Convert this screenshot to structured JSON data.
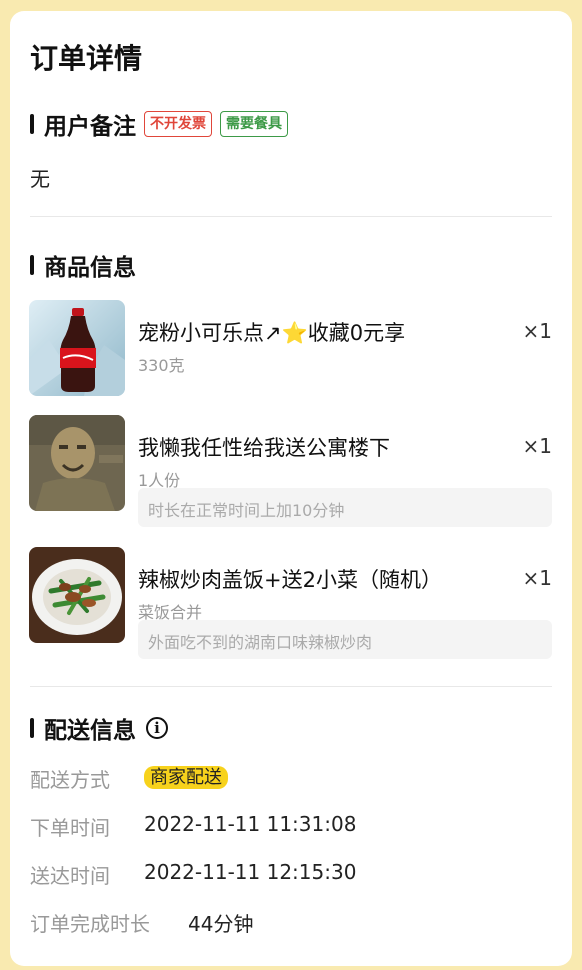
{
  "page": {
    "title": "订单详情"
  },
  "remarks": {
    "title": "用户备注",
    "tags": [
      "不开发票",
      "需要餐具"
    ],
    "content": "无"
  },
  "products": {
    "title": "商品信息",
    "items": [
      {
        "name": "宠粉小可乐点↗⭐收藏0元享",
        "quantity": "×1",
        "spec": "330克",
        "note": ""
      },
      {
        "name": "我懒我任性给我送公寓楼下",
        "quantity": "×1",
        "spec": "1人份",
        "note": "时长在正常时间上加10分钟"
      },
      {
        "name": "辣椒炒肉盖饭+送2小菜（随机）",
        "quantity": "×1",
        "spec": "菜饭合并",
        "note": "外面吃不到的湖南口味辣椒炒肉"
      }
    ]
  },
  "delivery": {
    "title": "配送信息",
    "icon": "info-icon",
    "rows": [
      {
        "label": "配送方式",
        "value": "商家配送"
      },
      {
        "label": "下单时间",
        "value": "2022-11-11 11:31:08"
      },
      {
        "label": "送达时间",
        "value": "2022-11-11 12:15:30"
      },
      {
        "label": "订单完成时长",
        "value": "44分钟"
      }
    ]
  },
  "colors": {
    "background": "#f9eab0",
    "badge": "#f7d21c",
    "tag_red": "#e0463a",
    "tag_green": "#3d9a47"
  }
}
